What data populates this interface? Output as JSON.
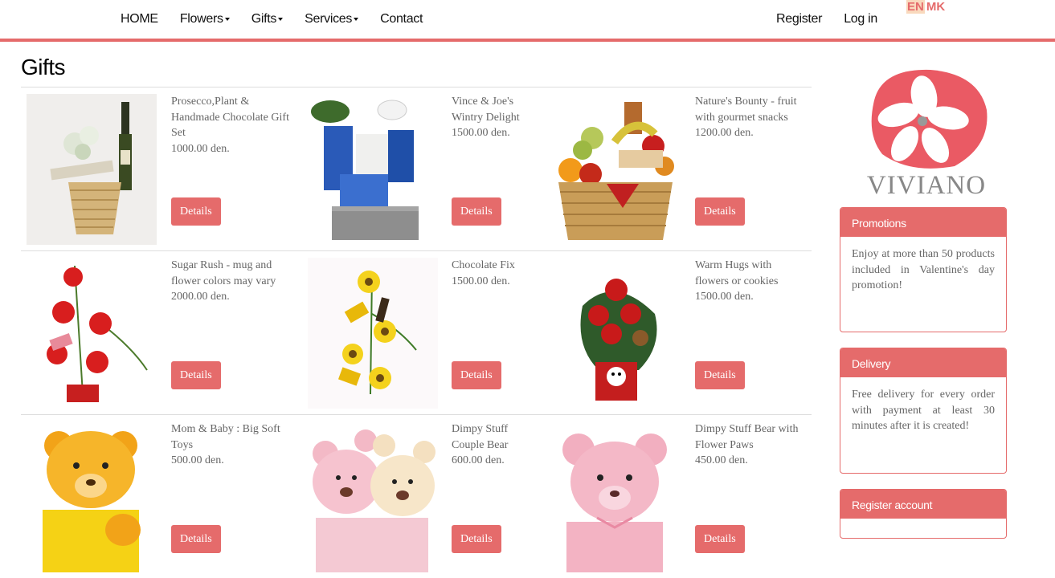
{
  "nav": {
    "home": "HOME",
    "flowers": "Flowers",
    "gifts": "Gifts",
    "services": "Services",
    "contact": "Contact",
    "register": "Register",
    "login": "Log in",
    "lang_en": "EN",
    "lang_mk": "MK"
  },
  "page": {
    "title": "Gifts"
  },
  "products": [
    {
      "name": "Prosecco,Plant & Handmade Chocolate Gift Set",
      "price": "1000.00 den.",
      "button": "Details"
    },
    {
      "name": "Vince & Joe's Wintry Delight",
      "price": "1500.00 den.",
      "button": "Details"
    },
    {
      "name": "Nature's Bounty - fruit with gourmet snacks",
      "price": "1200.00 den.",
      "button": "Details"
    },
    {
      "name": "Sugar Rush - mug and flower colors may vary",
      "price": "2000.00 den.",
      "button": "Details"
    },
    {
      "name": "Chocolate Fix",
      "price": "1500.00 den.",
      "button": "Details"
    },
    {
      "name": "Warm Hugs with flowers or cookies",
      "price": "1500.00 den.",
      "button": "Details"
    },
    {
      "name": "Mom & Baby : Big Soft Toys",
      "price": "500.00 den.",
      "button": "Details"
    },
    {
      "name": "Dimpy Stuff Couple Bear",
      "price": "600.00 den.",
      "button": "Details"
    },
    {
      "name": "Dimpy Stuff Bear with Flower Paws",
      "price": "450.00 den.",
      "button": "Details"
    }
  ],
  "sidebar": {
    "logo_text": "VIVIANO",
    "promotions": {
      "title": "Promotions",
      "text": "Enjoy at more than 50 products included in Valentine's day promotion!"
    },
    "delivery": {
      "title": "Delivery",
      "text": "Free delivery for every order with payment at least 30 minutes after it is created!"
    },
    "register": {
      "title": "Register account"
    }
  },
  "colors": {
    "accent": "#e56b6b",
    "lang_highlight": "#f9d9bd"
  }
}
